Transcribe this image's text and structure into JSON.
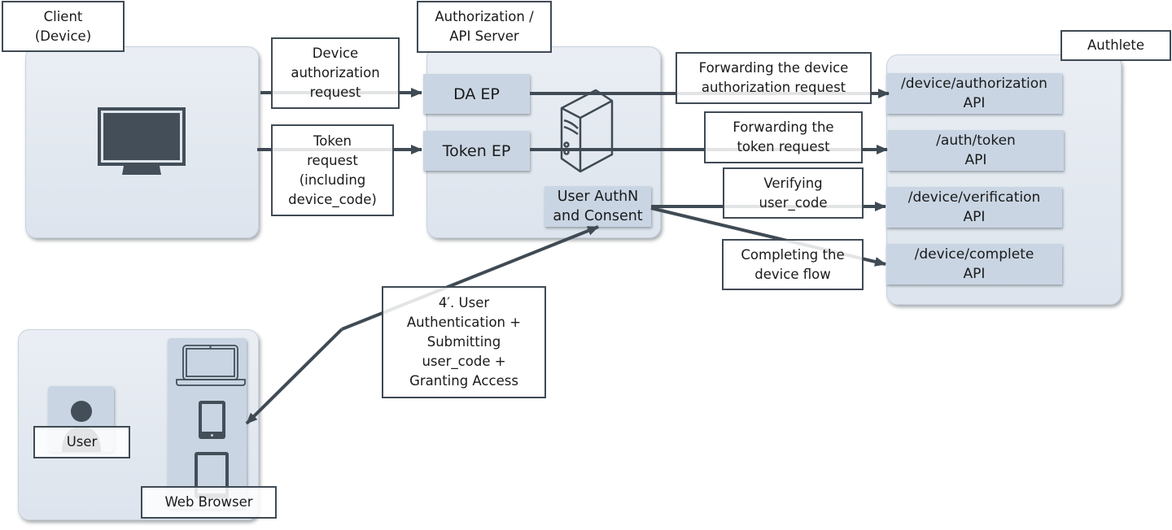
{
  "title_labels": {
    "client": "Client\n(Device)",
    "server": "Authorization /\nAPI Server",
    "authlete": "Authlete"
  },
  "server_endpoints": {
    "da_ep": "DA EP",
    "token_ep": "Token EP",
    "user_authn": "User AuthN\nand Consent"
  },
  "authlete_apis": [
    {
      "label": "/device/authorization\nAPI"
    },
    {
      "label": "/auth/token\nAPI"
    },
    {
      "label": "/device/verification\nAPI"
    },
    {
      "label": "/device/complete\nAPI"
    }
  ],
  "flow_labels": {
    "device_authorization_request": "Device\nauthorization\nrequest",
    "token_request": "Token\nrequest\n(including\ndevice_code)",
    "forward_device_authorization": "Forwarding the device\nauthorization request",
    "forward_token": "Forwarding the\ntoken request",
    "verifying_user_code": "Verifying\nuser_code",
    "completing_flow": "Completing the\ndevice flow",
    "user_authentication": "4′. User\nAuthentication +\nSubmitting\nuser_code +\nGranting Access"
  },
  "user_side": {
    "user": "User",
    "web_browser": "Web Browser"
  },
  "colors": {
    "line": "#3f4a54",
    "panel": "#e4e9f0",
    "endpoint": "#c9d5e3"
  }
}
